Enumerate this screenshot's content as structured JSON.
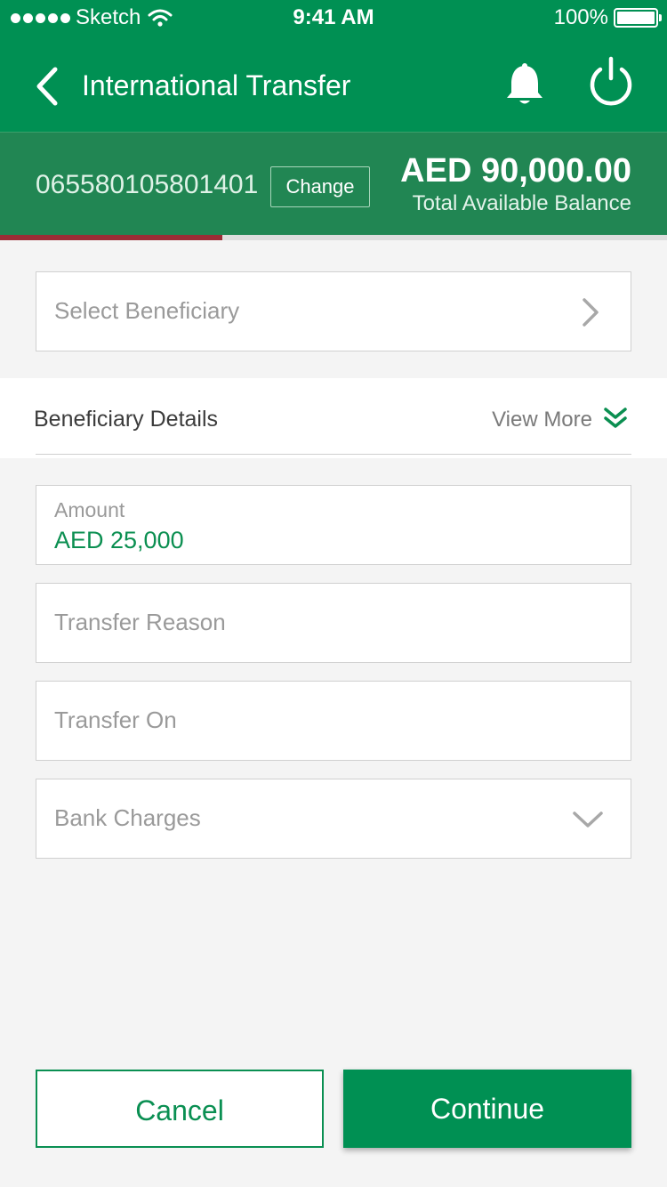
{
  "status_bar": {
    "carrier": "Sketch",
    "time": "9:41 AM",
    "battery": "100%"
  },
  "header": {
    "title": "International Transfer",
    "icons": [
      "back-chevron-icon",
      "bell-icon",
      "power-icon"
    ]
  },
  "account": {
    "number": "065580105801401",
    "change_label": "Change",
    "balance": "AED 90,000.00",
    "balance_label": "Total Available Balance"
  },
  "progress": {
    "fraction": 0.333
  },
  "form": {
    "beneficiary_placeholder": "Select Beneficiary",
    "beneficiary_details_title": "Beneficiary Details",
    "view_more_label": "View More",
    "amount_label": "Amount",
    "amount_value": "AED 25,000",
    "transfer_reason_placeholder": "Transfer Reason",
    "transfer_on_placeholder": "Transfer On",
    "bank_charges_placeholder": "Bank Charges"
  },
  "actions": {
    "cancel_label": "Cancel",
    "continue_label": "Continue"
  },
  "colors": {
    "primary_green": "#009053",
    "account_bar_green": "#218653",
    "progress_red": "#9b2d36",
    "background": "#f4f4f4"
  }
}
